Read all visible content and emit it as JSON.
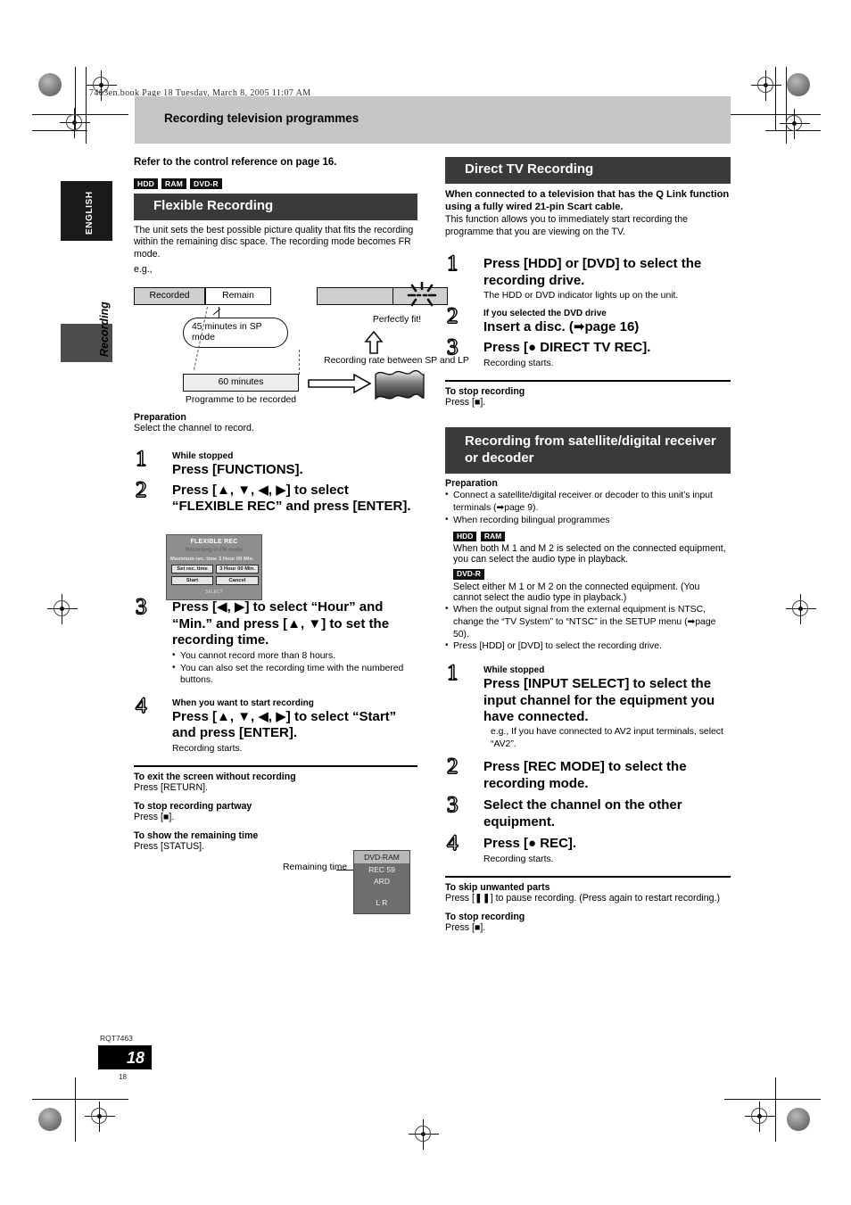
{
  "print_header": "7463en.book  Page 18  Tuesday, March 8, 2005  11:07 AM",
  "page_title": "Recording television programmes",
  "side_tab_language": "ENGLISH",
  "side_tab_chapter": "Recording",
  "footer": {
    "code": "RQT7463",
    "page_number": "18",
    "page_number_small": "18"
  },
  "left_column": {
    "reference_line": "Refer to the control reference on page 16.",
    "media_badges": [
      "HDD",
      "RAM",
      "DVD-R"
    ],
    "section_title": "Flexible Recording",
    "intro": "The unit sets the best possible picture quality that fits the recording within the remaining disc space. The recording mode becomes FR mode.",
    "eg_label": "e.g.,",
    "diagram": {
      "bar_recorded": "Recorded",
      "bar_remain": "Remain",
      "callout": "45 minutes in SP mode",
      "bar_programme": "60 minutes",
      "programme_caption": "Programme to be recorded",
      "perfect_fit": "Perfectly fit!",
      "rate_caption": "Recording rate between SP and LP"
    },
    "preparation_head": "Preparation",
    "preparation_text": "Select the channel to record.",
    "steps": [
      {
        "num": "1",
        "condition": "While stopped",
        "text": "Press [FUNCTIONS]."
      },
      {
        "num": "2",
        "condition": "",
        "text": "Press [▲, ▼, ◀, ▶] to select “FLEXIBLE REC” and press [ENTER]."
      },
      {
        "num": "3",
        "condition": "",
        "text": "Press [◀, ▶] to select “Hour” and “Min.” and press [▲, ▼] to set the recording time.",
        "bullets": [
          "You cannot record more than 8 hours.",
          "You can also set the recording time with the numbered buttons."
        ]
      },
      {
        "num": "4",
        "condition": "When you want to start recording",
        "text": "Press [▲, ▼, ◀, ▶] to select “Start” and press [ENTER].",
        "note": "Recording starts."
      }
    ],
    "osd_dialog": {
      "title": "FLEXIBLE REC",
      "subtitle": "Recording in FR mode",
      "max_label": "Maximum rec. time",
      "max_value": "3 Hour 00 Min.",
      "set_label": "Set rec. time",
      "set_value": "3 Hour 00 Min.",
      "start_button": "Start",
      "cancel_button": "Cancel",
      "select_hint": "SELECT"
    },
    "tips": [
      {
        "head": "To exit the screen without recording",
        "text": "Press [RETURN]."
      },
      {
        "head": "To stop recording partway",
        "text": "Press [■]."
      },
      {
        "head": "To show the remaining time",
        "text": "Press [STATUS]."
      }
    ],
    "front_display": {
      "remaining_label": "Remaining time",
      "disc": "DVD-RAM",
      "line1": "REC 59",
      "line2": "ARD",
      "line3": "L R"
    }
  },
  "right_column": {
    "direct_tv": {
      "section_title": "Direct TV Recording",
      "lead_bold": "When connected to a television that has the Q Link function using a fully wired 21-pin Scart cable.",
      "lead_text": "This function allows you to immediately start recording the programme that you are viewing on the TV.",
      "steps": [
        {
          "num": "1",
          "condition": "",
          "text": "Press [HDD] or [DVD] to select the recording drive.",
          "note": "The HDD or DVD indicator lights up on the unit."
        },
        {
          "num": "2",
          "condition": "If you selected the DVD drive",
          "text": "Insert a disc. (➡page 16)"
        },
        {
          "num": "3",
          "condition": "",
          "text": "Press [● DIRECT TV REC].",
          "note": "Recording starts."
        }
      ],
      "tip_head": "To stop recording",
      "tip_text": "Press [■]."
    },
    "satellite": {
      "section_title": "Recording from satellite/digital receiver or decoder",
      "preparation_head": "Preparation",
      "prep_b1": "Connect a satellite/digital receiver or decoder to this unit’s input terminals (➡page 9).",
      "prep_b2": "When recording bilingual programmes",
      "badges_hdd_ram": [
        "HDD",
        "RAM"
      ],
      "prep_b2_text": "When both M 1 and M 2 is selected on the connected equipment, you can select the audio type in playback.",
      "badge_dvdr": "DVD-R",
      "prep_b2_dvdr_text": "Select either M 1 or M 2 on the connected equipment. (You cannot select the audio type in playback.)",
      "prep_b3": "When the output signal from the external equipment is NTSC, change the “TV System” to “NTSC” in the SETUP menu (➡page 50).",
      "prep_b4": "Press [HDD] or [DVD] to select the recording drive.",
      "steps": [
        {
          "num": "1",
          "condition": "While stopped",
          "text": "Press [INPUT SELECT] to select the input channel for the equipment you have connected.",
          "note": "e.g., If you have connected to AV2 input terminals, select “AV2”."
        },
        {
          "num": "2",
          "condition": "",
          "text": "Press [REC MODE] to select the recording mode."
        },
        {
          "num": "3",
          "condition": "",
          "text": "Select the channel on the other equipment."
        },
        {
          "num": "4",
          "condition": "",
          "text": "Press [● REC].",
          "note": "Recording starts."
        }
      ],
      "tips": [
        {
          "head": "To skip unwanted parts",
          "text": "Press [❚❚] to pause recording. (Press again to restart recording.)"
        },
        {
          "head": "To stop recording",
          "text": "Press [■]."
        }
      ]
    }
  }
}
